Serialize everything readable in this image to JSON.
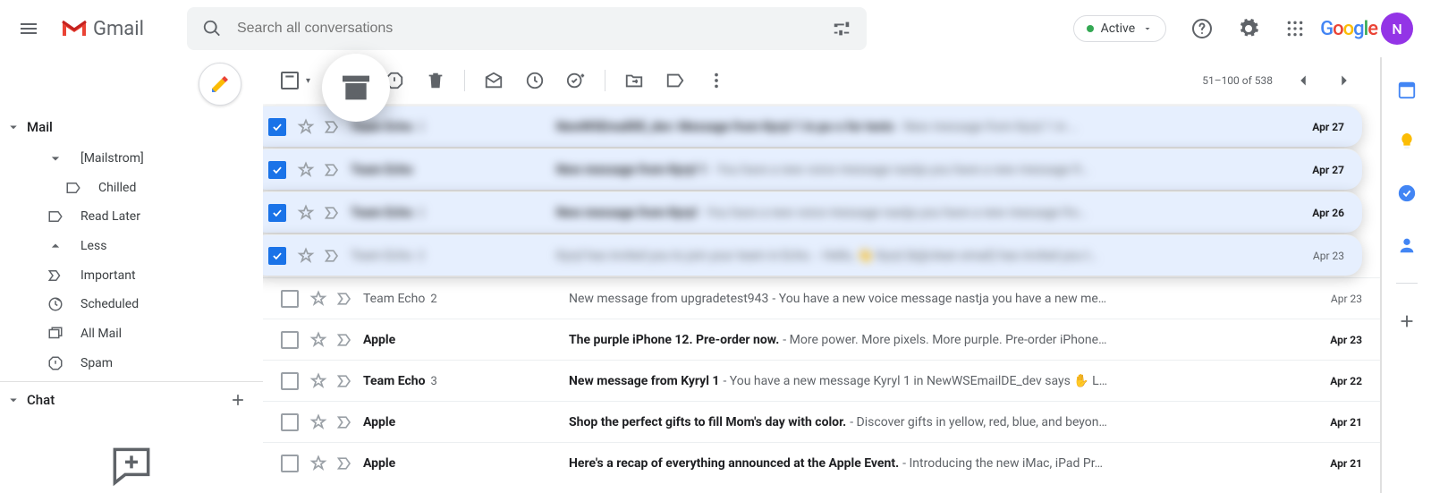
{
  "header": {
    "product_name": "Gmail",
    "search_placeholder": "Search all conversations",
    "status_label": "Active",
    "avatar_initial": "N"
  },
  "toolbar": {
    "counter": "51–100 of 538"
  },
  "sidebar": {
    "mail_label": "Mail",
    "chat_label": "Chat",
    "items": [
      {
        "label": "[Mailstrom]"
      },
      {
        "label": "Chilled"
      },
      {
        "label": "Read Later"
      },
      {
        "label": "Less"
      },
      {
        "label": "Important"
      },
      {
        "label": "Scheduled"
      },
      {
        "label": "All Mail"
      },
      {
        "label": "Spam"
      }
    ]
  },
  "rows": [
    {
      "selected": true,
      "unread": true,
      "blur": true,
      "drag": true,
      "sender": "Team Echo",
      "thread_count": "2",
      "subject": "NewWSEmailDE_dev: Message from Kyryl 1 in pu-s for tests",
      "preview": " - New message from Kyryl 1 in …",
      "date": "Apr 27"
    },
    {
      "selected": true,
      "unread": true,
      "blur": true,
      "drag": true,
      "sender": "Team Echo",
      "thread_count": "",
      "subject": "New message from Kyryl 1",
      "preview": " - You have a new voice message nastja you have a new message fr…",
      "date": "Apr 27"
    },
    {
      "selected": true,
      "unread": true,
      "blur": true,
      "drag": true,
      "sender": "Team Echo",
      "thread_count": "2",
      "subject": "New message from Kyryl",
      "preview": " - You have a new voice message nastja you have a new message fro…",
      "date": "Apr 26"
    },
    {
      "selected": true,
      "unread": false,
      "blur": true,
      "drag": true,
      "sender": "Team Echo",
      "thread_count": "2",
      "subject": "Kyryl has invited you to join your team in Echo.",
      "preview": " - Hello, 👋 Kyryl (k@clean email) has invited you t…",
      "date": "Apr 23"
    },
    {
      "selected": false,
      "unread": false,
      "blur": false,
      "drag": false,
      "sender": "Team Echo",
      "thread_count": "2",
      "subject": "New message from upgradetest943",
      "preview": " - You have a new voice message nastja you have a new me…",
      "date": "Apr 23"
    },
    {
      "selected": false,
      "unread": true,
      "blur": false,
      "drag": false,
      "sender": "Apple",
      "thread_count": "",
      "subject": "The purple iPhone 12. Pre-order now.",
      "preview": " - More power. More pixels. More purple. Pre-order iPhone…",
      "date": "Apr 23"
    },
    {
      "selected": false,
      "unread": true,
      "blur": false,
      "drag": false,
      "sender": "Team Echo",
      "thread_count": "3",
      "subject": "New message from Kyryl 1",
      "preview": " - You have a new message Kyryl 1 in NewWSEmailDE_dev says ✋ L…",
      "date": "Apr 22"
    },
    {
      "selected": false,
      "unread": true,
      "blur": false,
      "drag": false,
      "sender": "Apple",
      "thread_count": "",
      "subject": "Shop the perfect gifts to fill Mom's day with color.",
      "preview": " - Discover gifts in yellow, red, blue, and beyon…",
      "date": "Apr 21"
    },
    {
      "selected": false,
      "unread": true,
      "blur": false,
      "drag": false,
      "sender": "Apple",
      "thread_count": "",
      "subject": "Here's a recap of everything announced at the Apple Event.",
      "preview": " - Introducing the new iMac, iPad Pr…",
      "date": "Apr 21"
    }
  ]
}
